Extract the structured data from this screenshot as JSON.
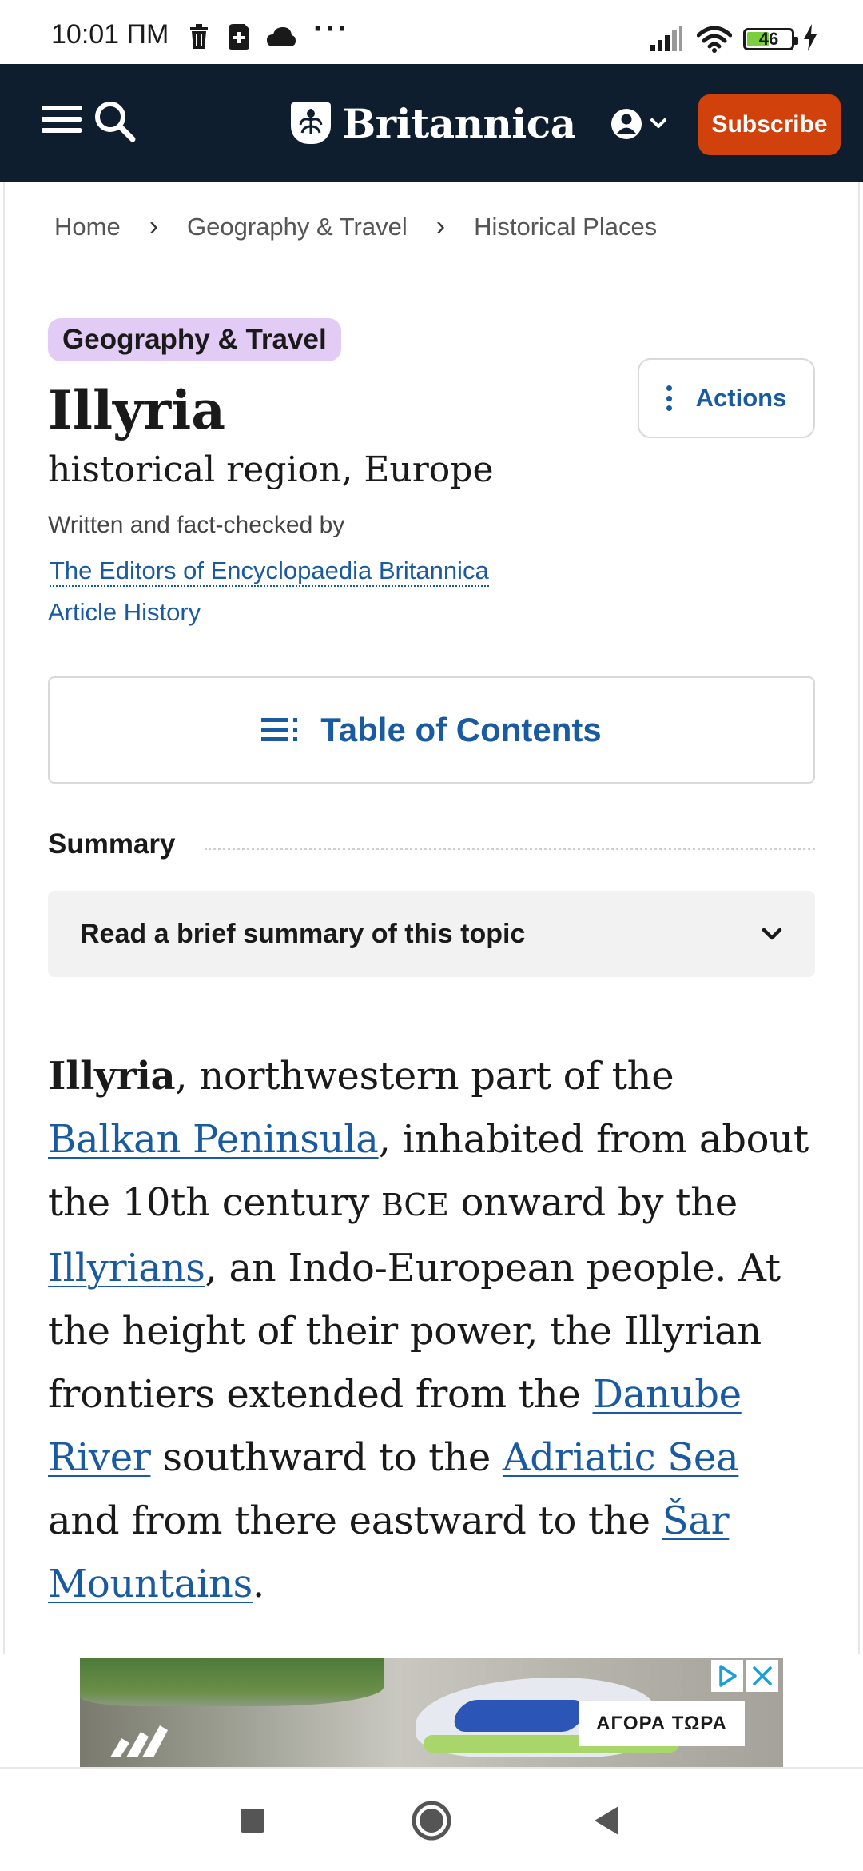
{
  "status_bar": {
    "time": "10:01 ПМ",
    "more_indicator": "···",
    "battery_level": "46",
    "battery_fraction": 0.46,
    "icons": [
      "trash-icon",
      "sim-icon",
      "cloud-icon",
      "signal-icon",
      "wifi-icon",
      "battery-icon",
      "charging-icon"
    ]
  },
  "header": {
    "menu_icon": "hamburger-icon",
    "search_icon": "search-icon",
    "logo_text": "Britannica",
    "account_icon": "user-icon",
    "subscribe_label": "Subscribe",
    "colors": {
      "background": "#0f1e2e",
      "subscribe": "#d1410c"
    }
  },
  "breadcrumb": {
    "items": [
      "Home",
      "Geography & Travel",
      "Historical Places"
    ],
    "separator": "›"
  },
  "article": {
    "category": "Geography & Travel",
    "title": "Illyria",
    "subtitle": "historical region, Europe",
    "byline_label": "Written and fact-checked by",
    "byline_link": "The Editors of Encyclopaedia Britannica",
    "history_link": "Article History",
    "actions_label": "Actions",
    "toc_label": "Table of Contents",
    "summary_heading": "Summary",
    "summary_toggle": "Read a brief summary of this topic",
    "body": {
      "lead": "Illyria",
      "t1": ", northwestern part of the ",
      "link1": "Balkan Peninsula",
      "t2": ", inhabited from about the 10th century ",
      "era": "BCE",
      "t3": " onward by the ",
      "link2": "Illyrians",
      "t4": ", an Indo-European people. At the height of their power, the Illyrian frontiers extended from the ",
      "link3": "Danube River",
      "t5": " southward to the ",
      "link4": "Adriatic Sea",
      "t6": " and from there eastward to the ",
      "link5": "Šar Mountains",
      "t7": "."
    },
    "colors": {
      "link": "#1a5aa0",
      "category_tag": "#e2cbf5"
    }
  },
  "ad": {
    "cta": "ΑΓΟΡΑ ΤΩΡΑ",
    "icons": [
      "adchoices-icon",
      "close-icon",
      "brand-logo"
    ]
  },
  "nav_bar": {
    "icons": [
      "recents-icon",
      "home-icon",
      "back-icon"
    ]
  }
}
